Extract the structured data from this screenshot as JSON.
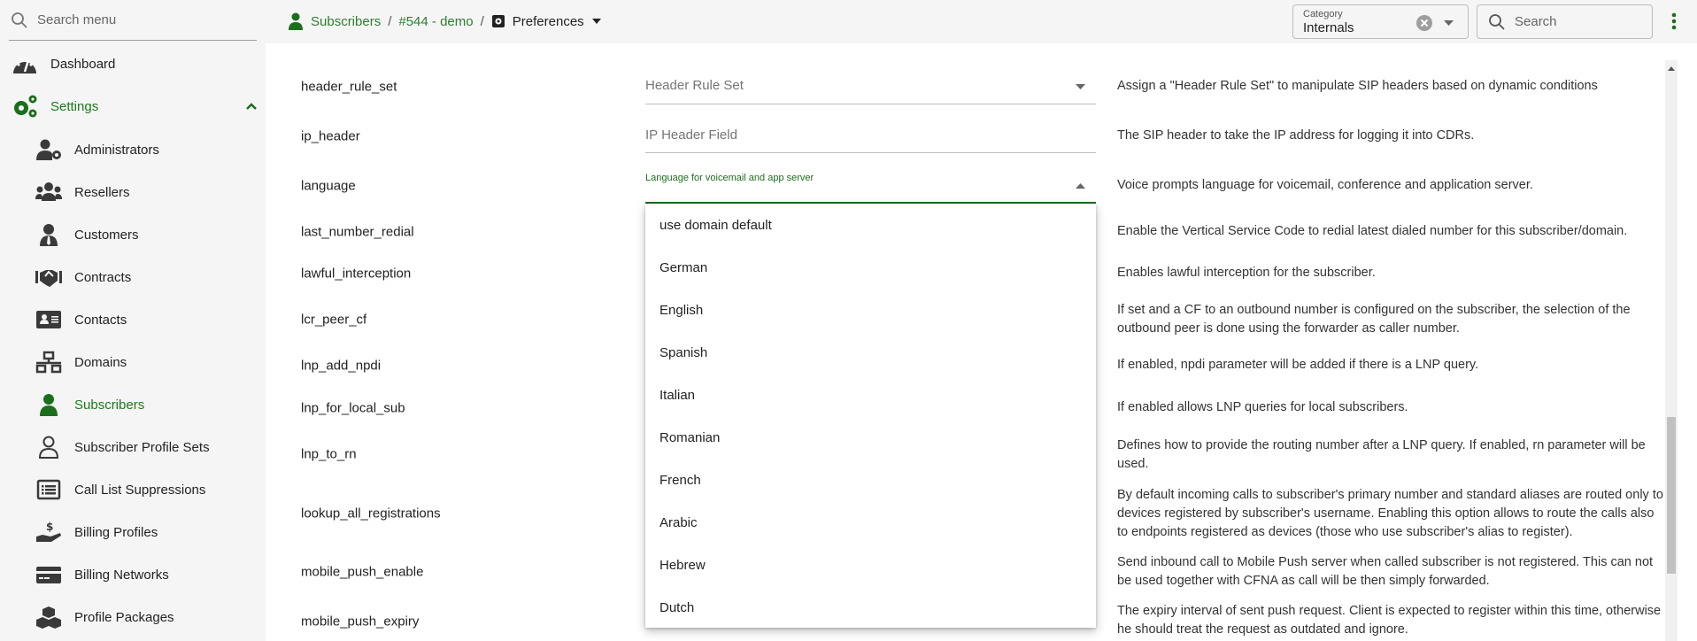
{
  "sidebar": {
    "search_placeholder": "Search menu",
    "items": [
      {
        "label": "Dashboard",
        "icon": "dashboard-icon"
      },
      {
        "label": "Settings",
        "icon": "gears-icon"
      },
      {
        "label": "Administrators",
        "icon": "user-cog-icon"
      },
      {
        "label": "Resellers",
        "icon": "users-icon"
      },
      {
        "label": "Customers",
        "icon": "user-tie-icon"
      },
      {
        "label": "Contracts",
        "icon": "handshake-icon"
      },
      {
        "label": "Contacts",
        "icon": "id-card-icon"
      },
      {
        "label": "Domains",
        "icon": "network-icon"
      },
      {
        "label": "Subscribers",
        "icon": "user-icon"
      },
      {
        "label": "Subscriber Profile Sets",
        "icon": "user-outline-icon"
      },
      {
        "label": "Call List Suppressions",
        "icon": "list-icon"
      },
      {
        "label": "Billing Profiles",
        "icon": "hand-dollar-icon"
      },
      {
        "label": "Billing Networks",
        "icon": "credit-card-icon"
      },
      {
        "label": "Profile Packages",
        "icon": "cubes-icon"
      }
    ]
  },
  "breadcrumb": {
    "subscribers": "Subscribers",
    "subscriber": "#544 - demo",
    "page": "Preferences"
  },
  "category": {
    "label": "Category",
    "value": "Internals"
  },
  "search": {
    "placeholder": "Search"
  },
  "colors": {
    "accent": "#1b6e1b"
  },
  "rows": [
    {
      "name": "header_rule_set",
      "field": "Header Rule Set",
      "desc": "Assign a \"Header Rule Set\" to manipulate SIP headers based on dynamic conditions"
    },
    {
      "name": "ip_header",
      "field": "IP Header Field",
      "desc": "The SIP header to take the IP address for logging it into CDRs."
    },
    {
      "name": "language",
      "field": "Language for voicemail and app server",
      "desc": "Voice prompts language for voicemail, conference and application server."
    },
    {
      "name": "last_number_redial",
      "desc": "Enable the Vertical Service Code to redial latest dialed number for this subscriber/domain."
    },
    {
      "name": "lawful_interception",
      "desc": "Enables lawful interception for the subscriber."
    },
    {
      "name": "lcr_peer_cf",
      "desc": "If set and a CF to an outbound number is configured on the subscriber, the selection of the outbound peer is done using the forwarder as caller number."
    },
    {
      "name": "lnp_add_npdi",
      "desc": "If enabled, npdi parameter will be added if there is a LNP query."
    },
    {
      "name": "lnp_for_local_sub",
      "desc": "If enabled allows LNP queries for local subscribers."
    },
    {
      "name": "lnp_to_rn",
      "desc": "Defines how to provide the routing number after a LNP query. If enabled, rn parameter will be used."
    },
    {
      "name": "lookup_all_registrations",
      "desc": "By default incoming calls to subscriber's primary number and standard aliases are routed only to devices registered by subscriber's username. Enabling this option allows to route the calls also to endpoints registered as devices (those who use subscriber's alias to register)."
    },
    {
      "name": "mobile_push_enable",
      "desc": "Send inbound call to Mobile Push server when called subscriber is not registered. This can not be used together with CFNA as call will be then simply forwarded."
    },
    {
      "name": "mobile_push_expiry",
      "desc": "The expiry interval of sent push request. Client is expected to register within this time, otherwise he should treat the request as outdated and ignore."
    }
  ],
  "language_options": [
    "use domain default",
    "German",
    "English",
    "Spanish",
    "Italian",
    "Romanian",
    "French",
    "Arabic",
    "Hebrew",
    "Dutch"
  ]
}
